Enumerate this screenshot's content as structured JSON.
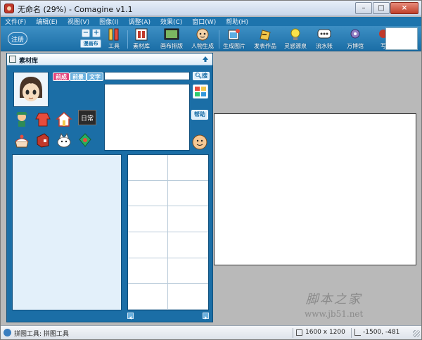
{
  "window": {
    "title": "无命名 (29%) - Comagine v1.1",
    "controls": {
      "minimize": "–",
      "maximize": "□",
      "close": "×"
    }
  },
  "menu": [
    "文件(F)",
    "编辑(E)",
    "视图(V)",
    "图像(I)",
    "调整(A)",
    "效果(C)",
    "窗口(W)",
    "帮助(H)"
  ],
  "toolbar": {
    "login": "注册",
    "canvas_label": "漫画布",
    "tools": [
      {
        "label": "工具",
        "icon": "tools-icon"
      },
      {
        "label": "素材库",
        "icon": "material-library-icon"
      },
      {
        "label": "画布排版",
        "icon": "canvas-layout-icon"
      },
      {
        "label": "人物生成",
        "icon": "character-generator-icon"
      },
      {
        "label": "生成图片",
        "icon": "generate-image-icon"
      },
      {
        "label": "发表作品",
        "icon": "publish-work-icon"
      },
      {
        "label": "灵感源泉",
        "icon": "inspiration-icon"
      },
      {
        "label": "流水账",
        "icon": "journal-icon"
      },
      {
        "label": "万博馆",
        "icon": "museum-icon"
      },
      {
        "label": "写",
        "icon": "write-icon"
      }
    ]
  },
  "panel": {
    "title": "素材库",
    "chips": [
      "前成",
      "前景",
      "文字"
    ],
    "search_placeholder": "",
    "search_button": "搜",
    "help_button": "帮助",
    "daily_label": "日常"
  },
  "status": {
    "tool_text": "拼图工具: 拼图工具",
    "canvas_size": "1600 x 1200",
    "coords": "-1500, -481"
  },
  "watermark": {
    "name": "脚本之家",
    "url": "www.jb51.net"
  },
  "colors": {
    "menu_bar": "#1d74ad",
    "toolbar": "#1b6ea6",
    "panel": "#1b6ea6",
    "accent_pink": "#e4427a"
  }
}
